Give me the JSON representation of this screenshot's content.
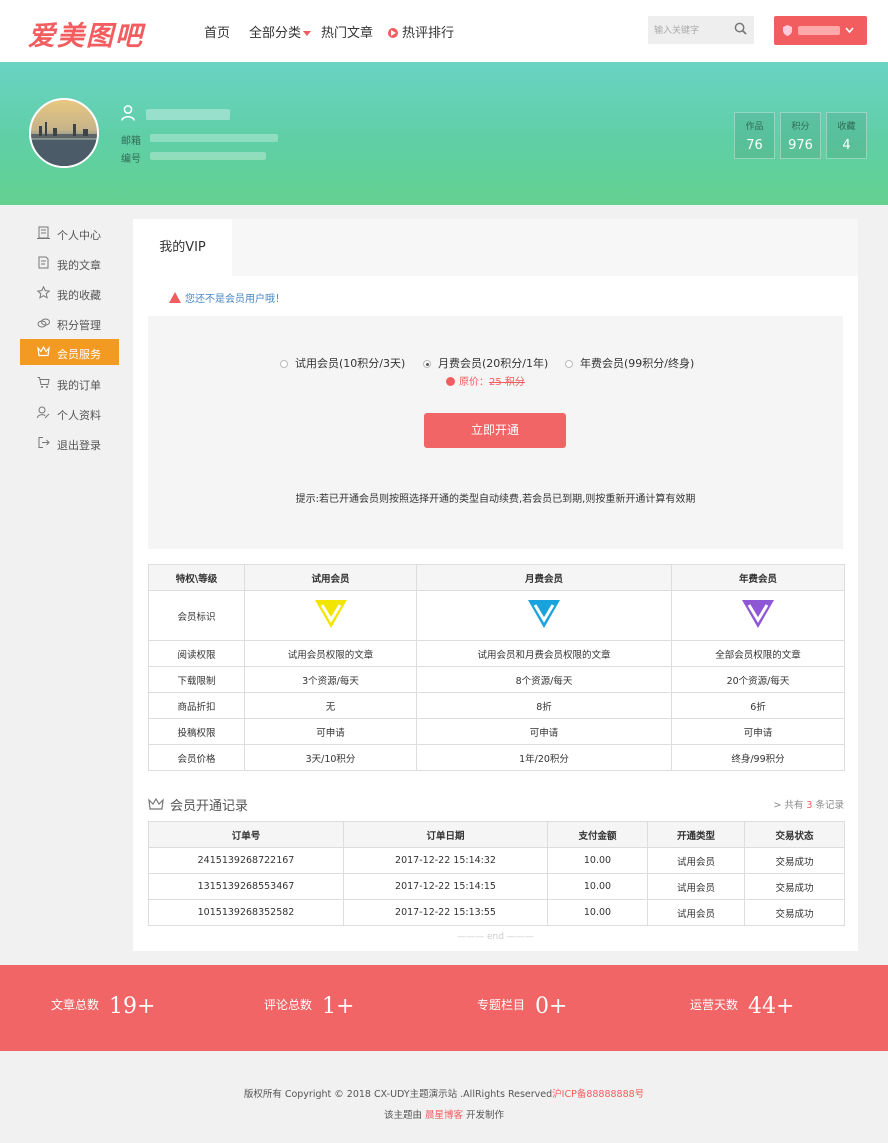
{
  "header": {
    "logo": "爱美图吧",
    "nav": {
      "home": "首页",
      "categories": "全部分类",
      "hot_articles": "热门文章",
      "hot_rank": "热评排行"
    },
    "search": {
      "placeholder": "输入关键字"
    }
  },
  "profile": {
    "email_label": "邮箱",
    "id_label": "编号",
    "stats": [
      {
        "label": "作品",
        "value": "76"
      },
      {
        "label": "积分",
        "value": "976"
      },
      {
        "label": "收藏",
        "value": "4"
      }
    ]
  },
  "sidebar": {
    "items": [
      {
        "label": "个人中心",
        "icon": "building-icon"
      },
      {
        "label": "我的文章",
        "icon": "document-icon"
      },
      {
        "label": "我的收藏",
        "icon": "star-icon"
      },
      {
        "label": "积分管理",
        "icon": "coins-icon"
      },
      {
        "label": "会员服务",
        "icon": "crown-icon",
        "active": true
      },
      {
        "label": "我的订单",
        "icon": "cart-icon"
      },
      {
        "label": "个人资料",
        "icon": "user-edit-icon"
      },
      {
        "label": "退出登录",
        "icon": "logout-icon"
      }
    ]
  },
  "main": {
    "tab": "我的VIP",
    "notice": "您还不是会员用户哦！",
    "options": [
      {
        "label": "试用会员(10积分/3天)",
        "selected": false
      },
      {
        "label": "月费会员(20积分/1年)",
        "selected": true
      },
      {
        "label": "年费会员(99积分/终身)",
        "selected": false
      }
    ],
    "original_price_label": "原价：",
    "original_price_value": "25 积分",
    "pay_button": "立即开通",
    "tip": "提示:若已开通会员则按照选择开通的类型自动续费,若会员已到期,则按重新开通计算有效期"
  },
  "privileges": {
    "headers": [
      "特权\\等级",
      "试用会员",
      "月费会员",
      "年费会员"
    ],
    "badge_row_label": "会员标识",
    "badge_colors": [
      "#f2e600",
      "#1aa2dc",
      "#8d57d6"
    ],
    "rows": [
      [
        "阅读权限",
        "试用会员权限的文章",
        "试用会员和月费会员权限的文章",
        "全部会员权限的文章"
      ],
      [
        "下载限制",
        "3个资源/每天",
        "8个资源/每天",
        "20个资源/每天"
      ],
      [
        "商品折扣",
        "无",
        "8折",
        "6折"
      ],
      [
        "投稿权限",
        "可申请",
        "可申请",
        "可申请"
      ],
      [
        "会员价格",
        "3天/10积分",
        "1年/20积分",
        "终身/99积分"
      ]
    ]
  },
  "records": {
    "title": "会员开通记录",
    "count_prefix": "> 共有",
    "count": "3",
    "count_suffix": "条记录",
    "headers": [
      "订单号",
      "订单日期",
      "支付金额",
      "开通类型",
      "交易状态"
    ],
    "rows": [
      [
        "2415139268722167",
        "2017-12-22 15:14:32",
        "10.00",
        "试用会员",
        "交易成功"
      ],
      [
        "1315139268553467",
        "2017-12-22 15:14:15",
        "10.00",
        "试用会员",
        "交易成功"
      ],
      [
        "1015139268352582",
        "2017-12-22 15:13:55",
        "10.00",
        "试用会员",
        "交易成功"
      ]
    ],
    "end": "——— end ———"
  },
  "site_stats": [
    {
      "label": "文章总数",
      "value": "19+"
    },
    {
      "label": "评论总数",
      "value": "1+"
    },
    {
      "label": "专题栏目",
      "value": "0+"
    },
    {
      "label": "运营天数",
      "value": "44+"
    }
  ],
  "footer": {
    "copyright": "版权所有 Copyright © 2018 CX-UDY主题演示站 .AllRights Reserved",
    "icp": "沪ICP备88888888号",
    "made_by_prefix": "该主题由",
    "made_by_link": "晨星博客",
    "made_by_suffix": "开发制作"
  },
  "colors": {
    "accent": "#f25d60",
    "active_sidebar": "#f39a22",
    "banner": "#62d0ae"
  }
}
